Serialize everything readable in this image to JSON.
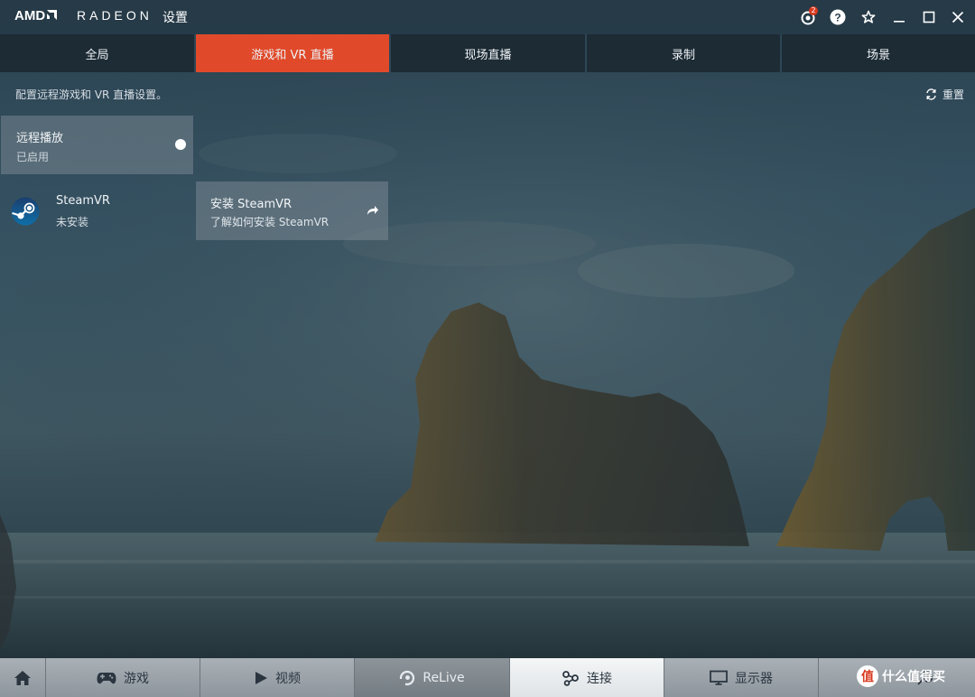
{
  "window": {
    "logo_amd": "AMD",
    "logo_radeon": "RADEON",
    "logo_settings": "设置",
    "notification_count": "2"
  },
  "tabs": [
    {
      "label": "全局",
      "active": false
    },
    {
      "label": "游戏和 VR 直播",
      "active": true
    },
    {
      "label": "现场直播",
      "active": false
    },
    {
      "label": "录制",
      "active": false
    },
    {
      "label": "场景",
      "active": false
    }
  ],
  "subtitle": "配置远程游戏和 VR 直播设置。",
  "reset_label": "重置",
  "remote_play": {
    "title": "远程播放",
    "status": "已启用"
  },
  "steamvr": {
    "name": "SteamVR",
    "status": "未安装",
    "install_title": "安装 SteamVR",
    "install_sub": "了解如何安装 SteamVR"
  },
  "bottom_nav": [
    {
      "label": "",
      "icon": "home-icon"
    },
    {
      "label": "游戏",
      "icon": "gamepad-icon"
    },
    {
      "label": "视频",
      "icon": "play-icon"
    },
    {
      "label": "ReLive",
      "icon": "relive-icon"
    },
    {
      "label": "连接",
      "icon": "connect-icon",
      "active": true
    },
    {
      "label": "显示器",
      "icon": "monitor-icon"
    },
    {
      "label": "",
      "icon": "system-icon"
    }
  ],
  "watermark": {
    "logo": "值",
    "text": "什么值得买"
  },
  "colors": {
    "accent": "#e04a2a",
    "tab_bg": "#1a262e",
    "badge": "#d9391f"
  }
}
